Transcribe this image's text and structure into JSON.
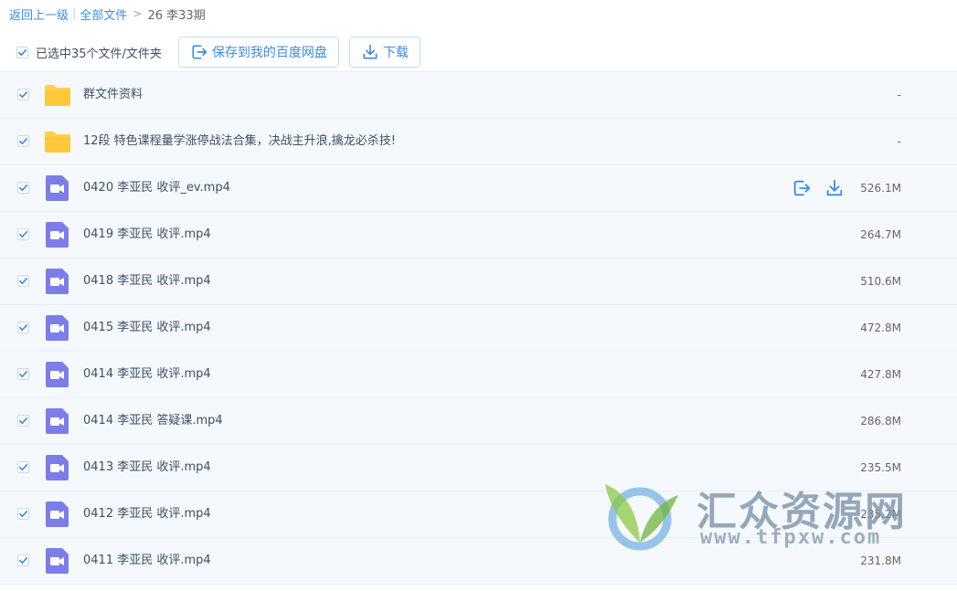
{
  "breadcrumb": {
    "back": "返回上一级",
    "all_files": "全部文件",
    "current": "26 李33期"
  },
  "toolbar": {
    "selected_label": "已选中35个文件/文件夹",
    "save_label": "保存到我的百度网盘",
    "download_label": "下载"
  },
  "colors": {
    "accent": "#3a8ee6",
    "folder": "#ffd04a",
    "video": "#7b7ee8"
  },
  "files": [
    {
      "name": "群文件资料",
      "size": "-",
      "type": "folder-icon"
    },
    {
      "name": "12段 特色课程量学涨停战法合集，决战主升浪,擒龙必杀技!",
      "size": "-",
      "type": "folder-icon"
    },
    {
      "name": "0420 李亚民 收评_ev.mp4",
      "size": "526.1M",
      "type": "video-icon"
    },
    {
      "name": "0419 李亚民 收评.mp4",
      "size": "264.7M",
      "type": "video-icon"
    },
    {
      "name": "0418 李亚民 收评.mp4",
      "size": "510.6M",
      "type": "video-icon"
    },
    {
      "name": "0415 李亚民 收评.mp4",
      "size": "472.8M",
      "type": "video-icon"
    },
    {
      "name": "0414 李亚民 收评.mp4",
      "size": "427.8M",
      "type": "video-icon"
    },
    {
      "name": "0414 李亚民 答疑课.mp4",
      "size": "286.8M",
      "type": "video-icon"
    },
    {
      "name": "0413 李亚民 收评.mp4",
      "size": "235.5M",
      "type": "video-icon"
    },
    {
      "name": "0412 李亚民 收评.mp4",
      "size": "235.2M",
      "type": "video-icon"
    },
    {
      "name": "0411 李亚民 收评.mp4",
      "size": "231.8M",
      "type": "video-icon"
    }
  ],
  "watermark": {
    "title": "汇众资源网",
    "url": "www.tfpxw.com"
  }
}
